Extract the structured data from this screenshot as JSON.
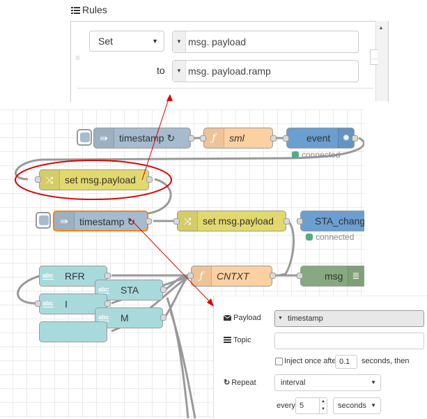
{
  "rules": {
    "title": "Rules",
    "action_select": "Set",
    "action_caret": "▼",
    "target_prefix": "msg.",
    "target_value": "payload",
    "to_label": "to",
    "source_prefix": "msg.",
    "source_value": "payload.ramp"
  },
  "flow": {
    "nodes": {
      "timestamp_top": "timestamp ↻",
      "sml": "sml",
      "event": "event",
      "set_msg_payload_1": "set msg.payload",
      "timestamp_2": "timestamp ↻",
      "set_msg_payload_2": "set msg.payload",
      "sta_change": "STA_chang",
      "cntxt": "CNTXT",
      "msg": "msg",
      "rfr": "RFR",
      "sta": "STA",
      "i": "I",
      "m": "M"
    },
    "status_connected_1": "connected",
    "status_connected_2": "connected",
    "abc_icon": "abc"
  },
  "inject": {
    "payload_label": "Payload",
    "payload_value": "timestamp",
    "topic_label": "Topic",
    "topic_value": "",
    "inject_once_label": "Inject once after",
    "inject_once_seconds": "0.1",
    "inject_once_suffix": "seconds, then",
    "repeat_label": "Repeat",
    "repeat_value": "interval",
    "every_label": "every",
    "every_value": "5",
    "every_unit": "seconds"
  },
  "colors": {
    "highlight_ellipse": "#e00000",
    "arrow": "#e00000",
    "node_blue": "#a6bbcf",
    "node_yellow": "#e2d96e",
    "node_orange": "#fdd0a2",
    "node_event": "#6b9ed1",
    "node_green": "#87a980",
    "node_cyan": "#a8dadc",
    "status_green": "#55aa88"
  }
}
